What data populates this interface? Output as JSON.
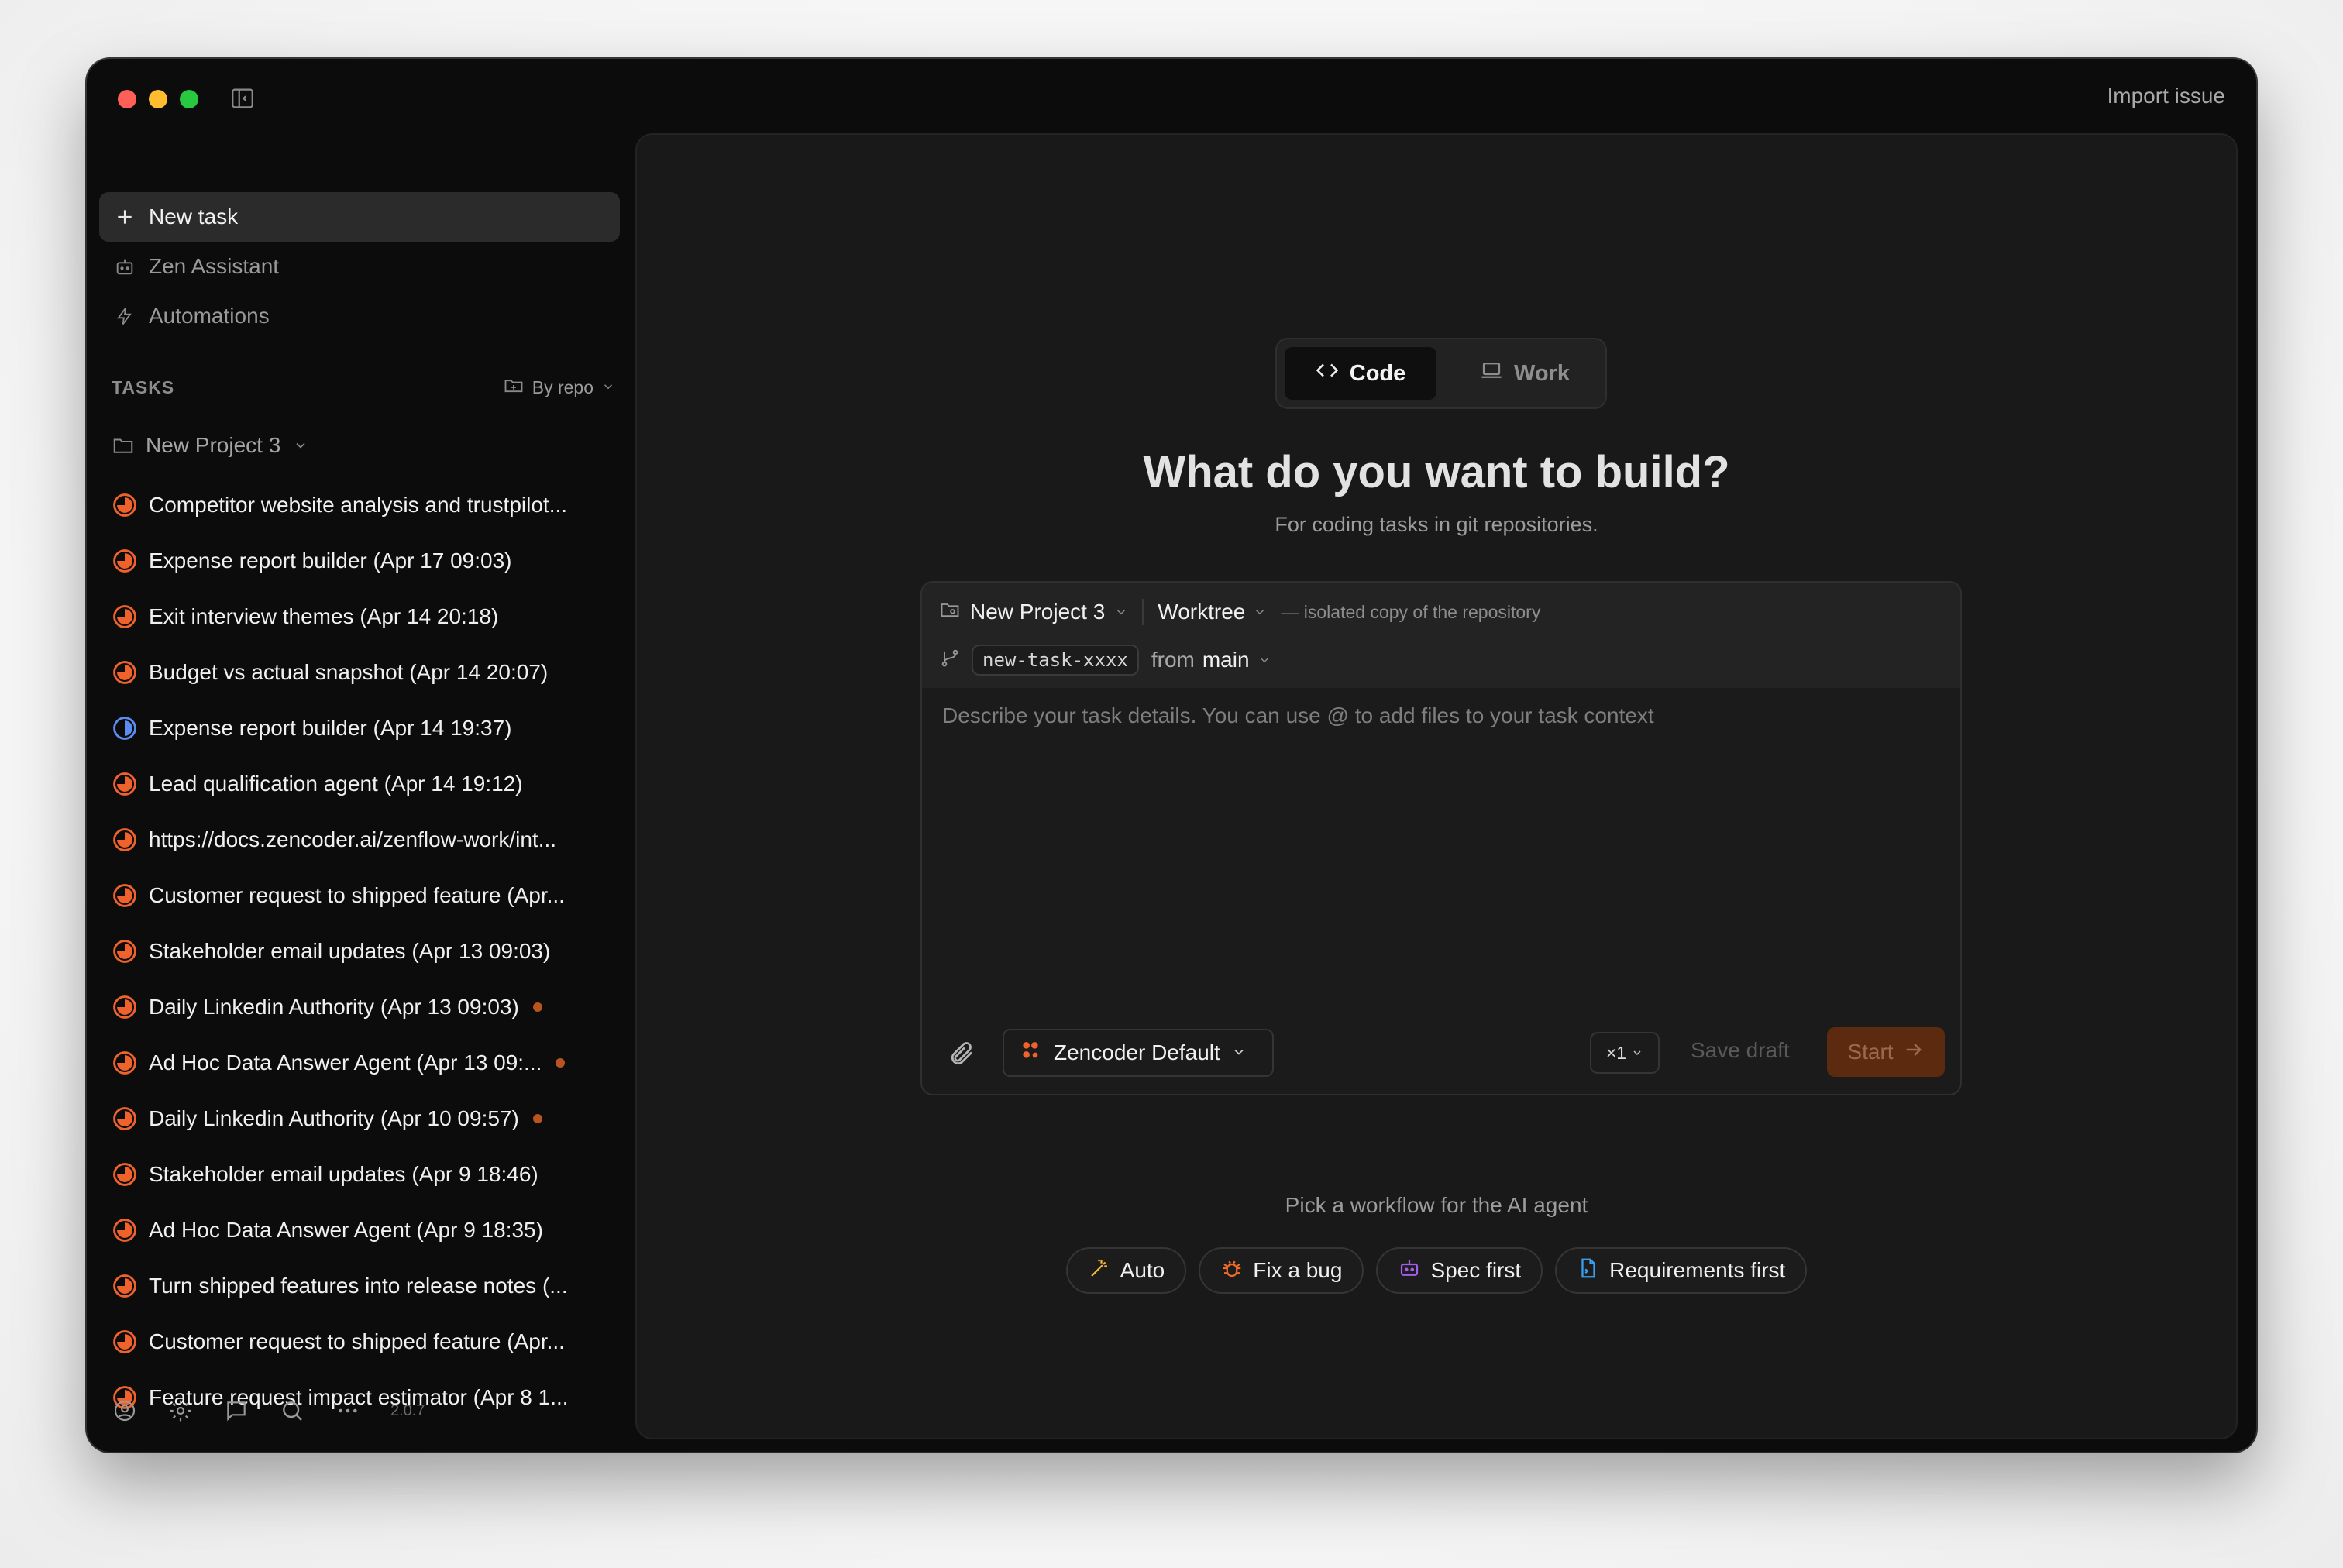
{
  "titlebar": {
    "import_issue": "Import issue"
  },
  "sidebar": {
    "nav": [
      {
        "label": "New task",
        "icon": "plus-icon"
      },
      {
        "label": "Zen Assistant",
        "icon": "robot-icon"
      },
      {
        "label": "Automations",
        "icon": "lightning-icon"
      }
    ],
    "tasks_title": "TASKS",
    "by_repo": "By repo",
    "project": "New Project 3",
    "tasks": [
      {
        "label": "Competitor website analysis and trustpilot...",
        "status": "in-progress",
        "dot": false
      },
      {
        "label": "Expense report builder (Apr 17 09:03)",
        "status": "in-progress",
        "dot": false
      },
      {
        "label": "Exit interview themes (Apr 14 20:18)",
        "status": "in-progress",
        "dot": false
      },
      {
        "label": "Budget vs actual snapshot (Apr 14 20:07)",
        "status": "in-progress",
        "dot": false
      },
      {
        "label": "Expense report builder (Apr 14 19:37)",
        "status": "half",
        "dot": false
      },
      {
        "label": "Lead qualification agent (Apr 14 19:12)",
        "status": "in-progress",
        "dot": false
      },
      {
        "label": "https://docs.zencoder.ai/zenflow-work/int...",
        "status": "in-progress",
        "dot": false
      },
      {
        "label": "Customer request to shipped feature (Apr...",
        "status": "in-progress",
        "dot": false
      },
      {
        "label": "Stakeholder email updates (Apr 13 09:03)",
        "status": "in-progress",
        "dot": false
      },
      {
        "label": "Daily Linkedin Authority (Apr 13 09:03)",
        "status": "in-progress",
        "dot": true
      },
      {
        "label": "Ad Hoc Data Answer Agent (Apr 13 09:...",
        "status": "in-progress",
        "dot": true
      },
      {
        "label": "Daily Linkedin Authority (Apr 10 09:57)",
        "status": "in-progress",
        "dot": true
      },
      {
        "label": "Stakeholder email updates (Apr 9 18:46)",
        "status": "in-progress",
        "dot": false
      },
      {
        "label": "Ad Hoc Data Answer Agent (Apr 9 18:35)",
        "status": "in-progress",
        "dot": false
      },
      {
        "label": "Turn shipped features into release notes (...",
        "status": "in-progress",
        "dot": false
      },
      {
        "label": "Customer request to shipped feature (Apr...",
        "status": "in-progress",
        "dot": false
      },
      {
        "label": "Feature request impact estimator (Apr 8 1...",
        "status": "in-progress",
        "dot": false
      }
    ],
    "version": "2.0.7"
  },
  "main": {
    "modes": {
      "code": "Code",
      "work": "Work",
      "selected": "Code"
    },
    "headline": "What do you want to build?",
    "subline": "For coding tasks in git repositories.",
    "composer": {
      "project": "New Project 3",
      "worktree": "Worktree",
      "worktree_note": "— isolated copy of the repository",
      "branch": "new-task-xxxx",
      "from_label": "from",
      "base_branch": "main",
      "placeholder": "Describe your task details. You can use @ to add files to your task context",
      "value": "",
      "model": "Zencoder Default",
      "multiplier": "×1",
      "save_draft": "Save draft",
      "start": "Start"
    },
    "pick_text": "Pick a workflow for the AI agent",
    "workflows": [
      {
        "label": "Auto",
        "icon": "magic-wand-icon",
        "color": "#f5b73b"
      },
      {
        "label": "Fix a bug",
        "icon": "bug-icon",
        "color": "#f06a2a"
      },
      {
        "label": "Spec first",
        "icon": "robot-icon",
        "color": "#a55cf0"
      },
      {
        "label": "Requirements first",
        "icon": "document-icon",
        "color": "#3aa0f0"
      }
    ]
  },
  "colors": {
    "accent": "#f0622b",
    "start_bg": "#5b2a0f",
    "status_blue": "#5b8cf0"
  }
}
